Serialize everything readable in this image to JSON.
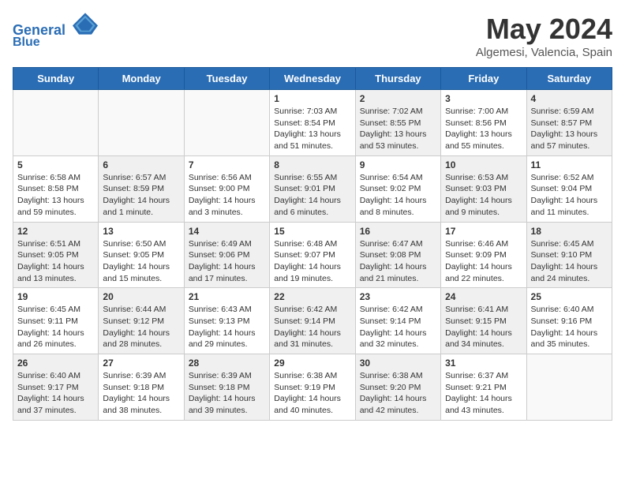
{
  "header": {
    "logo_line1": "General",
    "logo_line2": "Blue",
    "month": "May 2024",
    "location": "Algemesi, Valencia, Spain"
  },
  "weekdays": [
    "Sunday",
    "Monday",
    "Tuesday",
    "Wednesday",
    "Thursday",
    "Friday",
    "Saturday"
  ],
  "weeks": [
    [
      {
        "day": "",
        "info": "",
        "shaded": false,
        "empty": true
      },
      {
        "day": "",
        "info": "",
        "shaded": false,
        "empty": true
      },
      {
        "day": "",
        "info": "",
        "shaded": false,
        "empty": true
      },
      {
        "day": "1",
        "info": "Sunrise: 7:03 AM\nSunset: 8:54 PM\nDaylight: 13 hours\nand 51 minutes.",
        "shaded": false,
        "empty": false
      },
      {
        "day": "2",
        "info": "Sunrise: 7:02 AM\nSunset: 8:55 PM\nDaylight: 13 hours\nand 53 minutes.",
        "shaded": true,
        "empty": false
      },
      {
        "day": "3",
        "info": "Sunrise: 7:00 AM\nSunset: 8:56 PM\nDaylight: 13 hours\nand 55 minutes.",
        "shaded": false,
        "empty": false
      },
      {
        "day": "4",
        "info": "Sunrise: 6:59 AM\nSunset: 8:57 PM\nDaylight: 13 hours\nand 57 minutes.",
        "shaded": true,
        "empty": false
      }
    ],
    [
      {
        "day": "5",
        "info": "Sunrise: 6:58 AM\nSunset: 8:58 PM\nDaylight: 13 hours\nand 59 minutes.",
        "shaded": false,
        "empty": false
      },
      {
        "day": "6",
        "info": "Sunrise: 6:57 AM\nSunset: 8:59 PM\nDaylight: 14 hours\nand 1 minute.",
        "shaded": true,
        "empty": false
      },
      {
        "day": "7",
        "info": "Sunrise: 6:56 AM\nSunset: 9:00 PM\nDaylight: 14 hours\nand 3 minutes.",
        "shaded": false,
        "empty": false
      },
      {
        "day": "8",
        "info": "Sunrise: 6:55 AM\nSunset: 9:01 PM\nDaylight: 14 hours\nand 6 minutes.",
        "shaded": true,
        "empty": false
      },
      {
        "day": "9",
        "info": "Sunrise: 6:54 AM\nSunset: 9:02 PM\nDaylight: 14 hours\nand 8 minutes.",
        "shaded": false,
        "empty": false
      },
      {
        "day": "10",
        "info": "Sunrise: 6:53 AM\nSunset: 9:03 PM\nDaylight: 14 hours\nand 9 minutes.",
        "shaded": true,
        "empty": false
      },
      {
        "day": "11",
        "info": "Sunrise: 6:52 AM\nSunset: 9:04 PM\nDaylight: 14 hours\nand 11 minutes.",
        "shaded": false,
        "empty": false
      }
    ],
    [
      {
        "day": "12",
        "info": "Sunrise: 6:51 AM\nSunset: 9:05 PM\nDaylight: 14 hours\nand 13 minutes.",
        "shaded": true,
        "empty": false
      },
      {
        "day": "13",
        "info": "Sunrise: 6:50 AM\nSunset: 9:05 PM\nDaylight: 14 hours\nand 15 minutes.",
        "shaded": false,
        "empty": false
      },
      {
        "day": "14",
        "info": "Sunrise: 6:49 AM\nSunset: 9:06 PM\nDaylight: 14 hours\nand 17 minutes.",
        "shaded": true,
        "empty": false
      },
      {
        "day": "15",
        "info": "Sunrise: 6:48 AM\nSunset: 9:07 PM\nDaylight: 14 hours\nand 19 minutes.",
        "shaded": false,
        "empty": false
      },
      {
        "day": "16",
        "info": "Sunrise: 6:47 AM\nSunset: 9:08 PM\nDaylight: 14 hours\nand 21 minutes.",
        "shaded": true,
        "empty": false
      },
      {
        "day": "17",
        "info": "Sunrise: 6:46 AM\nSunset: 9:09 PM\nDaylight: 14 hours\nand 22 minutes.",
        "shaded": false,
        "empty": false
      },
      {
        "day": "18",
        "info": "Sunrise: 6:45 AM\nSunset: 9:10 PM\nDaylight: 14 hours\nand 24 minutes.",
        "shaded": true,
        "empty": false
      }
    ],
    [
      {
        "day": "19",
        "info": "Sunrise: 6:45 AM\nSunset: 9:11 PM\nDaylight: 14 hours\nand 26 minutes.",
        "shaded": false,
        "empty": false
      },
      {
        "day": "20",
        "info": "Sunrise: 6:44 AM\nSunset: 9:12 PM\nDaylight: 14 hours\nand 28 minutes.",
        "shaded": true,
        "empty": false
      },
      {
        "day": "21",
        "info": "Sunrise: 6:43 AM\nSunset: 9:13 PM\nDaylight: 14 hours\nand 29 minutes.",
        "shaded": false,
        "empty": false
      },
      {
        "day": "22",
        "info": "Sunrise: 6:42 AM\nSunset: 9:14 PM\nDaylight: 14 hours\nand 31 minutes.",
        "shaded": true,
        "empty": false
      },
      {
        "day": "23",
        "info": "Sunrise: 6:42 AM\nSunset: 9:14 PM\nDaylight: 14 hours\nand 32 minutes.",
        "shaded": false,
        "empty": false
      },
      {
        "day": "24",
        "info": "Sunrise: 6:41 AM\nSunset: 9:15 PM\nDaylight: 14 hours\nand 34 minutes.",
        "shaded": true,
        "empty": false
      },
      {
        "day": "25",
        "info": "Sunrise: 6:40 AM\nSunset: 9:16 PM\nDaylight: 14 hours\nand 35 minutes.",
        "shaded": false,
        "empty": false
      }
    ],
    [
      {
        "day": "26",
        "info": "Sunrise: 6:40 AM\nSunset: 9:17 PM\nDaylight: 14 hours\nand 37 minutes.",
        "shaded": true,
        "empty": false
      },
      {
        "day": "27",
        "info": "Sunrise: 6:39 AM\nSunset: 9:18 PM\nDaylight: 14 hours\nand 38 minutes.",
        "shaded": false,
        "empty": false
      },
      {
        "day": "28",
        "info": "Sunrise: 6:39 AM\nSunset: 9:18 PM\nDaylight: 14 hours\nand 39 minutes.",
        "shaded": true,
        "empty": false
      },
      {
        "day": "29",
        "info": "Sunrise: 6:38 AM\nSunset: 9:19 PM\nDaylight: 14 hours\nand 40 minutes.",
        "shaded": false,
        "empty": false
      },
      {
        "day": "30",
        "info": "Sunrise: 6:38 AM\nSunset: 9:20 PM\nDaylight: 14 hours\nand 42 minutes.",
        "shaded": true,
        "empty": false
      },
      {
        "day": "31",
        "info": "Sunrise: 6:37 AM\nSunset: 9:21 PM\nDaylight: 14 hours\nand 43 minutes.",
        "shaded": false,
        "empty": false
      },
      {
        "day": "",
        "info": "",
        "shaded": true,
        "empty": true
      }
    ]
  ]
}
